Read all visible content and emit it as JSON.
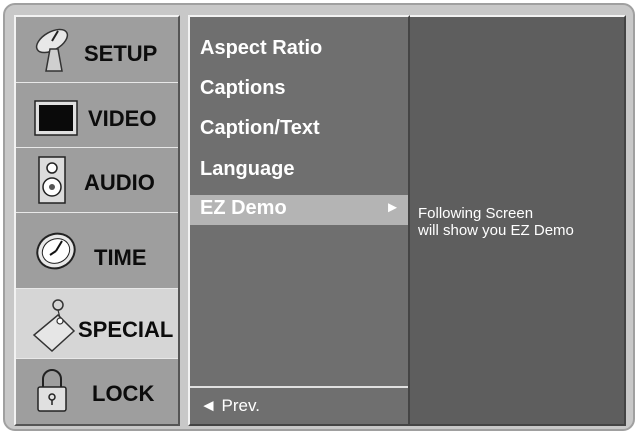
{
  "menu": {
    "items": [
      {
        "label": "SETUP",
        "icon": "satellite-dish-icon",
        "selected": false
      },
      {
        "label": "VIDEO",
        "icon": "tv-screen-icon",
        "selected": false
      },
      {
        "label": "AUDIO",
        "icon": "speaker-icon",
        "selected": false
      },
      {
        "label": "TIME",
        "icon": "clock-icon",
        "selected": false
      },
      {
        "label": "SPECIAL",
        "icon": "tag-icon",
        "selected": true
      },
      {
        "label": "LOCK",
        "icon": "padlock-icon",
        "selected": false
      }
    ]
  },
  "submenu": {
    "items": [
      "Aspect Ratio",
      "Captions",
      "Caption/Text",
      "Language"
    ],
    "selected_label": "EZ Demo",
    "selected_arrow": "►",
    "prev_label": "◄ Prev."
  },
  "description": {
    "line1": "Following Screen",
    "line2": "will show you EZ Demo"
  },
  "colors": {
    "frame": "#c8c8c8",
    "left_panel": "#9e9e9e",
    "selected_item": "#d6d6d6",
    "mid_panel": "#6f6f6f",
    "right_panel": "#5e5e5e",
    "highlight_bar": "#b4b4b4"
  }
}
